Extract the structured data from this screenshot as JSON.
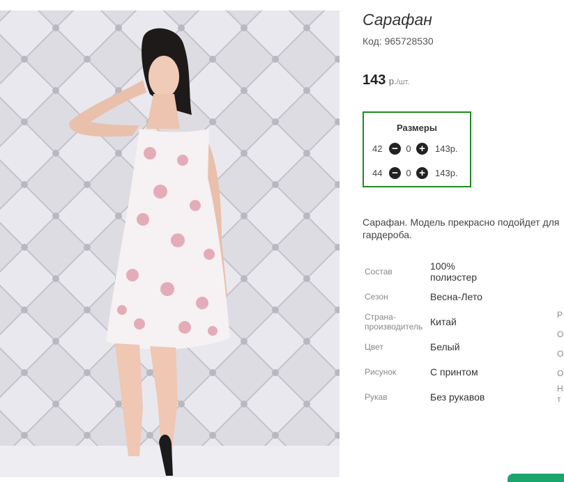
{
  "product": {
    "title": "Сарафан",
    "code": "Код: 965728530",
    "price": "143",
    "price_unit": "р.",
    "price_per": "/шт."
  },
  "sizes": {
    "header": "Размеры",
    "rows": [
      {
        "size": "42",
        "qty": "0",
        "price": "143р."
      },
      {
        "size": "44",
        "qty": "0",
        "price": "143р."
      }
    ]
  },
  "description": "Сарафан. Модель прекрасно подойдет для гардероба.",
  "properties": [
    {
      "key": "Состав",
      "value": "100% полиэстер"
    },
    {
      "key": "Сезон",
      "value": "Весна-Лето"
    },
    {
      "key": "Страна-производитель",
      "value": "Китай"
    },
    {
      "key": "Цвет",
      "value": "Белый"
    },
    {
      "key": "Рисунок",
      "value": "С принтом"
    },
    {
      "key": "Рукав",
      "value": "Без рукавов"
    }
  ],
  "right_column_fragments": [
    "Р",
    "О",
    "О",
    "О",
    "Н",
    "т"
  ],
  "colors": {
    "accent_green": "#1e8a1e",
    "bottom_tab": "#1aa56c"
  }
}
